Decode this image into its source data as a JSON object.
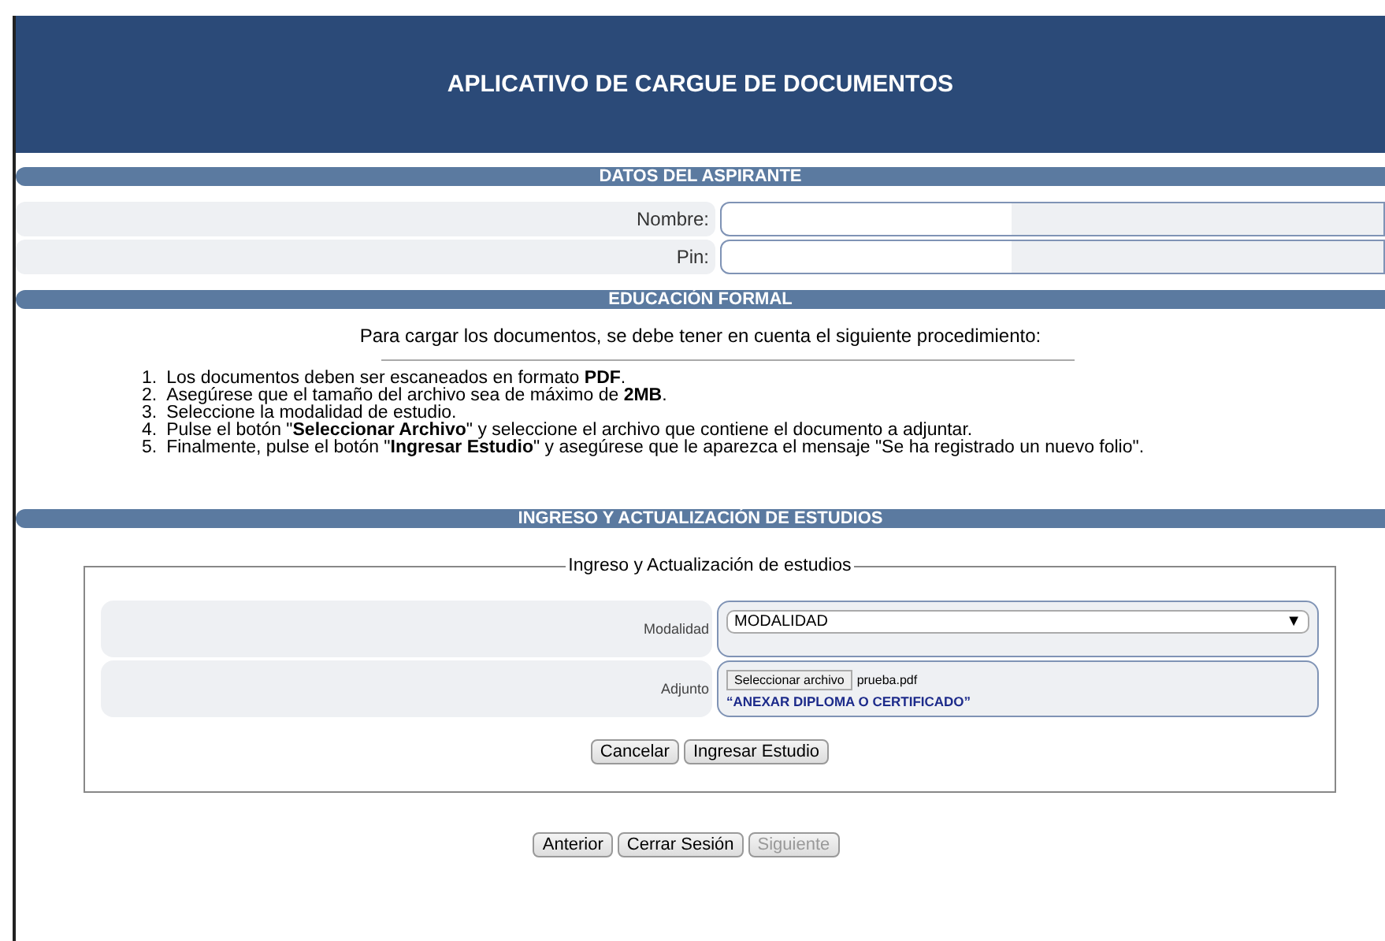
{
  "header": {
    "title": "APLICATIVO DE CARGUE DE DOCUMENTOS"
  },
  "applicant": {
    "heading": "DATOS DEL ASPIRANTE",
    "fields": [
      {
        "label": "Nombre:"
      },
      {
        "label": "Pin:"
      }
    ]
  },
  "education": {
    "heading": "EDUCACIÓN FORMAL",
    "intro": "Para cargar los documentos, se debe tener en cuenta el siguiente procedimiento:",
    "steps": [
      {
        "number": "1.",
        "text": "Los documentos deben ser escaneados en formato **PDF**."
      },
      {
        "number": "2.",
        "text": "Asegúrese que el tamaño del archivo sea de máximo de **2MB**."
      },
      {
        "number": "3.",
        "text": "Seleccione la modalidad de estudio."
      },
      {
        "number": "4.",
        "text": "Pulse el botón \"**Seleccionar Archivo**\"  y seleccione el archivo que contiene el documento a adjuntar."
      },
      {
        "number": "5.",
        "text": "Finalmente, pulse el botón \"**Ingresar Estudio**\" y asegúrese que le aparezca el mensaje  \"Se ha registrado un nuevo folio\"."
      }
    ]
  },
  "studies": {
    "heading": "INGRESO Y ACTUALIZACIÓN DE ESTUDIOS",
    "legend": "Ingreso y Actualización de estudios",
    "modality": {
      "label": "Modalidad",
      "value": "MODALIDAD",
      "arrow": "▼"
    },
    "attachment": {
      "label": "Adjunto",
      "button": "Seleccionar archivo",
      "file": "prueba.pdf",
      "note": "“ANEXAR DIPLOMA O CERTIFICADO”"
    },
    "buttons": [
      {
        "label": "Cancelar",
        "disabled": false
      },
      {
        "label": "Ingresar Estudio",
        "disabled": false
      }
    ]
  },
  "navigation": [
    {
      "label": "Anterior",
      "disabled": false
    },
    {
      "label": "Cerrar Sesión",
      "disabled": false
    },
    {
      "label": "Siguiente",
      "disabled": true
    }
  ]
}
